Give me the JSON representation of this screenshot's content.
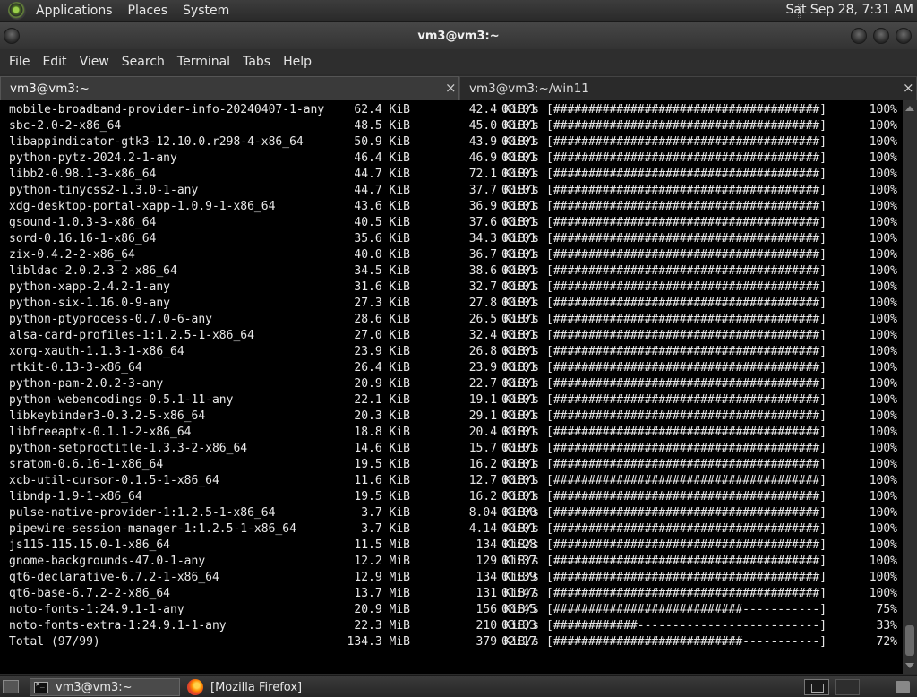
{
  "top_panel": {
    "menus": [
      "Applications",
      "Places",
      "System"
    ],
    "clock": "Sat Sep 28,  7:31 AM"
  },
  "window": {
    "title": "vm3@vm3:~"
  },
  "menubar": {
    "items": [
      "File",
      "Edit",
      "View",
      "Search",
      "Terminal",
      "Tabs",
      "Help"
    ]
  },
  "tabs": [
    {
      "label": "vm3@vm3:~",
      "close": "×"
    },
    {
      "label": "vm3@vm3:~/win11",
      "close": "×"
    }
  ],
  "terminal": {
    "rows": [
      {
        "name": "mobile-broadband-provider-info-20240407-1-any",
        "size": "62.4 KiB",
        "speed": "42.4 KiB/s",
        "time": "00:01",
        "bar": "[######################################]",
        "pct": "100%"
      },
      {
        "name": "sbc-2.0-2-x86_64",
        "size": "48.5 KiB",
        "speed": "45.0 KiB/s",
        "time": "00:01",
        "bar": "[######################################]",
        "pct": "100%"
      },
      {
        "name": "libappindicator-gtk3-12.10.0.r298-4-x86_64",
        "size": "50.9 KiB",
        "speed": "43.9 KiB/s",
        "time": "00:01",
        "bar": "[######################################]",
        "pct": "100%"
      },
      {
        "name": "python-pytz-2024.2-1-any",
        "size": "46.4 KiB",
        "speed": "46.9 KiB/s",
        "time": "00:01",
        "bar": "[######################################]",
        "pct": "100%"
      },
      {
        "name": "libb2-0.98.1-3-x86_64",
        "size": "44.7 KiB",
        "speed": "72.1 KiB/s",
        "time": "00:01",
        "bar": "[######################################]",
        "pct": "100%"
      },
      {
        "name": "python-tinycss2-1.3.0-1-any",
        "size": "44.7 KiB",
        "speed": "37.7 KiB/s",
        "time": "00:01",
        "bar": "[######################################]",
        "pct": "100%"
      },
      {
        "name": "xdg-desktop-portal-xapp-1.0.9-1-x86_64",
        "size": "43.6 KiB",
        "speed": "36.9 KiB/s",
        "time": "00:01",
        "bar": "[######################################]",
        "pct": "100%"
      },
      {
        "name": "gsound-1.0.3-3-x86_64",
        "size": "40.5 KiB",
        "speed": "37.6 KiB/s",
        "time": "00:01",
        "bar": "[######################################]",
        "pct": "100%"
      },
      {
        "name": "sord-0.16.16-1-x86_64",
        "size": "35.6 KiB",
        "speed": "34.3 KiB/s",
        "time": "00:01",
        "bar": "[######################################]",
        "pct": "100%"
      },
      {
        "name": "zix-0.4.2-2-x86_64",
        "size": "40.0 KiB",
        "speed": "36.7 KiB/s",
        "time": "00:01",
        "bar": "[######################################]",
        "pct": "100%"
      },
      {
        "name": "libldac-2.0.2.3-2-x86_64",
        "size": "34.5 KiB",
        "speed": "38.6 KiB/s",
        "time": "00:01",
        "bar": "[######################################]",
        "pct": "100%"
      },
      {
        "name": "python-xapp-2.4.2-1-any",
        "size": "31.6 KiB",
        "speed": "32.7 KiB/s",
        "time": "00:01",
        "bar": "[######################################]",
        "pct": "100%"
      },
      {
        "name": "python-six-1.16.0-9-any",
        "size": "27.3 KiB",
        "speed": "27.8 KiB/s",
        "time": "00:01",
        "bar": "[######################################]",
        "pct": "100%"
      },
      {
        "name": "python-ptyprocess-0.7.0-6-any",
        "size": "28.6 KiB",
        "speed": "26.5 KiB/s",
        "time": "00:01",
        "bar": "[######################################]",
        "pct": "100%"
      },
      {
        "name": "alsa-card-profiles-1:1.2.5-1-x86_64",
        "size": "27.0 KiB",
        "speed": "32.4 KiB/s",
        "time": "00:01",
        "bar": "[######################################]",
        "pct": "100%"
      },
      {
        "name": "xorg-xauth-1.1.3-1-x86_64",
        "size": "23.9 KiB",
        "speed": "26.8 KiB/s",
        "time": "00:01",
        "bar": "[######################################]",
        "pct": "100%"
      },
      {
        "name": "rtkit-0.13-3-x86_64",
        "size": "26.4 KiB",
        "speed": "23.9 KiB/s",
        "time": "00:01",
        "bar": "[######################################]",
        "pct": "100%"
      },
      {
        "name": "python-pam-2.0.2-3-any",
        "size": "20.9 KiB",
        "speed": "22.7 KiB/s",
        "time": "00:01",
        "bar": "[######################################]",
        "pct": "100%"
      },
      {
        "name": "python-webencodings-0.5.1-11-any",
        "size": "22.1 KiB",
        "speed": "19.1 KiB/s",
        "time": "00:01",
        "bar": "[######################################]",
        "pct": "100%"
      },
      {
        "name": "libkeybinder3-0.3.2-5-x86_64",
        "size": "20.3 KiB",
        "speed": "29.1 KiB/s",
        "time": "00:01",
        "bar": "[######################################]",
        "pct": "100%"
      },
      {
        "name": "libfreeaptx-0.1.1-2-x86_64",
        "size": "18.8 KiB",
        "speed": "20.4 KiB/s",
        "time": "00:01",
        "bar": "[######################################]",
        "pct": "100%"
      },
      {
        "name": "python-setproctitle-1.3.3-2-x86_64",
        "size": "14.6 KiB",
        "speed": "15.7 KiB/s",
        "time": "00:01",
        "bar": "[######################################]",
        "pct": "100%"
      },
      {
        "name": "sratom-0.6.16-1-x86_64",
        "size": "19.5 KiB",
        "speed": "16.2 KiB/s",
        "time": "00:01",
        "bar": "[######################################]",
        "pct": "100%"
      },
      {
        "name": "xcb-util-cursor-0.1.5-1-x86_64",
        "size": "11.6 KiB",
        "speed": "12.7 KiB/s",
        "time": "00:01",
        "bar": "[######################################]",
        "pct": "100%"
      },
      {
        "name": "libndp-1.9-1-x86_64",
        "size": "19.5 KiB",
        "speed": "16.2 KiB/s",
        "time": "00:01",
        "bar": "[######################################]",
        "pct": "100%"
      },
      {
        "name": "pulse-native-provider-1:1.2.5-1-x86_64",
        "size": "3.7 KiB",
        "speed": "8.04 KiB/s",
        "time": "00:00",
        "bar": "[######################################]",
        "pct": "100%"
      },
      {
        "name": "pipewire-session-manager-1:1.2.5-1-x86_64",
        "size": "3.7 KiB",
        "speed": "4.14 KiB/s",
        "time": "00:01",
        "bar": "[######################################]",
        "pct": "100%"
      },
      {
        "name": "js115-115.15.0-1-x86_64",
        "size": "11.5 MiB",
        "speed": "134 KiB/s",
        "time": "01:28",
        "bar": "[######################################]",
        "pct": "100%"
      },
      {
        "name": "gnome-backgrounds-47.0-1-any",
        "size": "12.2 MiB",
        "speed": "129 KiB/s",
        "time": "01:37",
        "bar": "[######################################]",
        "pct": "100%"
      },
      {
        "name": "qt6-declarative-6.7.2-1-x86_64",
        "size": "12.9 MiB",
        "speed": "134 KiB/s",
        "time": "01:39",
        "bar": "[######################################]",
        "pct": "100%"
      },
      {
        "name": "qt6-base-6.7.2-2-x86_64",
        "size": "13.7 MiB",
        "speed": "131 KiB/s",
        "time": "01:47",
        "bar": "[######################################]",
        "pct": "100%"
      },
      {
        "name": "noto-fonts-1:24.9.1-1-any",
        "size": "20.9 MiB",
        "speed": "156 KiB/s",
        "time": "00:45",
        "bar": "[###########################-----------]",
        "pct": "75%"
      },
      {
        "name": "noto-fonts-extra-1:24.9.1-1-any",
        "size": "22.3 MiB",
        "speed": "210 KiB/s",
        "time": "03:33",
        "bar": "[############--------------------------]",
        "pct": "33%"
      },
      {
        "name": "Total (97/99)",
        "size": "134.3 MiB",
        "speed": "379 KiB/s",
        "time": "02:17",
        "bar": "[###########################-----------]",
        "pct": "72%"
      }
    ]
  },
  "taskbar": {
    "tasks": [
      "vm3@vm3:~",
      "[Mozilla Firefox]"
    ]
  }
}
